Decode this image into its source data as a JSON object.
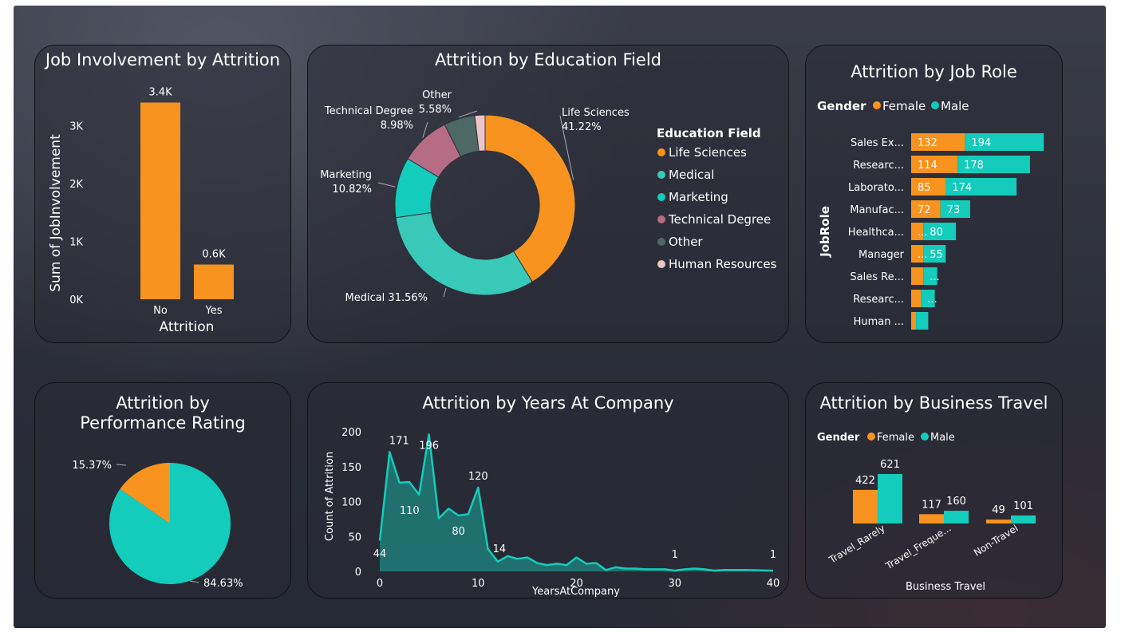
{
  "colors": {
    "female": "#f7931e",
    "male": "#13ccbc",
    "life_sciences": "#f7931e",
    "medical": "#38c9b8",
    "marketing": "#13ccbc",
    "technical_degree": "#b56c84",
    "other": "#4c6965",
    "human_resources": "#ecc4c8",
    "area": "#1e7d78",
    "line": "#13ccbc"
  },
  "cards": {
    "job_involvement": {
      "title": "Job Involvement by Attrition"
    },
    "education": {
      "title": "Attrition by Education Field"
    },
    "job_role": {
      "title": "Attrition by Job Role"
    },
    "performance": {
      "title": "Attrition by Performance Rating"
    },
    "years": {
      "title": "Attrition by Years At Company"
    },
    "travel": {
      "title": "Attrition by Business Travel"
    }
  },
  "chart_data": [
    {
      "id": "job_involvement",
      "type": "bar",
      "title": "Job Involvement by Attrition",
      "categories": [
        "No",
        "Yes"
      ],
      "values": [
        3400,
        600
      ],
      "value_labels": [
        "3.4K",
        "0.6K"
      ],
      "xlabel": "Attrition",
      "ylabel": "Sum of JobInvolvement",
      "yticks": [
        {
          "v": 0,
          "label": "0K"
        },
        {
          "v": 1000,
          "label": "1K"
        },
        {
          "v": 2000,
          "label": "2K"
        },
        {
          "v": 3000,
          "label": "3K"
        }
      ],
      "ylim": [
        0,
        3500
      ]
    },
    {
      "id": "education",
      "type": "pie",
      "title": "Attrition by Education Field",
      "legend_title": "Education Field",
      "slices": [
        {
          "label": "Life Sciences",
          "value": 41.22,
          "pct_label": "41.22%",
          "color_key": "life_sciences"
        },
        {
          "label": "Medical",
          "value": 31.56,
          "pct_label": "31.56%",
          "color_key": "medical"
        },
        {
          "label": "Marketing",
          "value": 10.82,
          "pct_label": "10.82%",
          "color_key": "marketing"
        },
        {
          "label": "Technical Degree",
          "value": 8.98,
          "pct_label": "8.98%",
          "color_key": "technical_degree"
        },
        {
          "label": "Other",
          "value": 5.58,
          "pct_label": "5.58%",
          "color_key": "other"
        },
        {
          "label": "Human Resources",
          "value": 1.84,
          "pct_label": "",
          "color_key": "human_resources"
        }
      ]
    },
    {
      "id": "job_role",
      "type": "bar",
      "orientation": "horizontal",
      "stacked": true,
      "title": "Attrition by Job Role",
      "legend_title": "Gender",
      "ylabel": "JobRole",
      "categories": [
        "Sales Ex...",
        "Researc...",
        "Laborato...",
        "Manufac...",
        "Healthca...",
        "Manager",
        "Sales Re...",
        "Researc...",
        "Human ..."
      ],
      "series": [
        {
          "name": "Female",
          "values": [
            132,
            114,
            85,
            72,
            30,
            30,
            30,
            24,
            12
          ],
          "labels": [
            "132",
            "114",
            "85",
            "72",
            "...",
            "...",
            "",
            "",
            ""
          ]
        },
        {
          "name": "Male",
          "values": [
            194,
            178,
            174,
            73,
            80,
            55,
            34,
            34,
            30
          ],
          "labels": [
            "194",
            "178",
            "174",
            "73",
            "80",
            "55",
            "...",
            "...",
            ""
          ]
        }
      ]
    },
    {
      "id": "performance",
      "type": "pie",
      "title": "Attrition by Performance Rating",
      "slices": [
        {
          "value": 84.63,
          "pct_label": "84.63%",
          "color_key": "male"
        },
        {
          "value": 15.37,
          "pct_label": "15.37%",
          "color_key": "female"
        }
      ]
    },
    {
      "id": "years",
      "type": "area",
      "title": "Attrition by Years At Company",
      "xlabel": "YearsAtCompany",
      "ylabel": "Count of Attrition",
      "x": [
        0,
        1,
        2,
        3,
        4,
        5,
        6,
        7,
        8,
        9,
        10,
        11,
        12,
        13,
        14,
        15,
        16,
        17,
        18,
        19,
        20,
        21,
        22,
        23,
        24,
        25,
        26,
        27,
        28,
        29,
        30,
        31,
        32,
        33,
        34,
        35,
        36,
        37,
        40
      ],
      "y": [
        44,
        171,
        127,
        128,
        110,
        196,
        76,
        90,
        80,
        82,
        120,
        32,
        14,
        22,
        18,
        20,
        12,
        9,
        11,
        9,
        20,
        11,
        12,
        2,
        6,
        4,
        4,
        3,
        3,
        3,
        1,
        3,
        4,
        3,
        1,
        2,
        2,
        2,
        1
      ],
      "point_labels": [
        {
          "x": 0,
          "label": "44"
        },
        {
          "x": 1,
          "label": "171"
        },
        {
          "x": 4,
          "label": "110"
        },
        {
          "x": 5,
          "label": "196"
        },
        {
          "x": 8,
          "label": "80"
        },
        {
          "x": 10,
          "label": "120"
        },
        {
          "x": 12,
          "label": "14"
        },
        {
          "x": 30,
          "label": "1"
        },
        {
          "x": 40,
          "label": "1"
        }
      ],
      "xticks": [
        0,
        10,
        20,
        30,
        40
      ],
      "yticks": [
        0,
        50,
        100,
        150,
        200
      ],
      "xlim": [
        0,
        40
      ],
      "ylim": [
        0,
        200
      ]
    },
    {
      "id": "travel",
      "type": "bar",
      "title": "Attrition by Business Travel",
      "legend_title": "Gender",
      "xlabel": "Business Travel",
      "categories": [
        "Travel_Rarely",
        "Travel_Freque...",
        "Non-Travel"
      ],
      "series": [
        {
          "name": "Female",
          "values": [
            422,
            117,
            49
          ]
        },
        {
          "name": "Male",
          "values": [
            621,
            160,
            101
          ]
        }
      ]
    }
  ]
}
